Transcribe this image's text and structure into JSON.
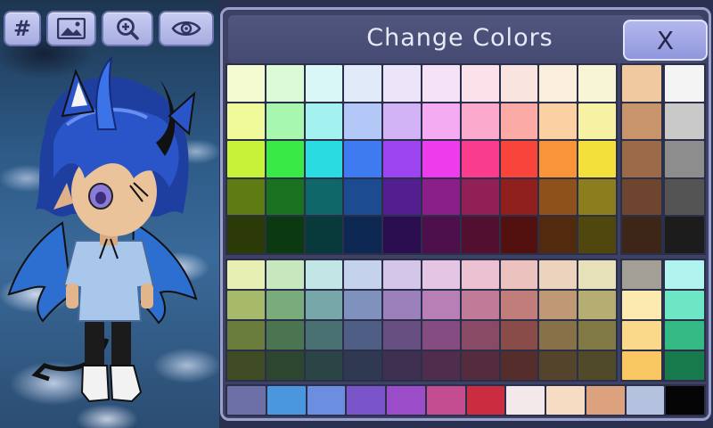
{
  "panel": {
    "title": "Change Colors",
    "close_label": "X"
  },
  "toolbar": {
    "hash_label": "#",
    "buttons": [
      "hex-code",
      "background-image",
      "zoom-in",
      "visibility"
    ]
  },
  "icons": {
    "image": "image-icon",
    "zoom": "zoom-in-icon",
    "eye": "eye-icon"
  },
  "palette_top": [
    [
      "#f4fbd0",
      "#dbfbd6",
      "#d8f7f6",
      "#e1eaf8",
      "#ece4f8",
      "#f6e2f6",
      "#fbe2ea",
      "#fae4df",
      "#faeedd",
      "#f7f5d6"
    ],
    [
      "#f1fa9a",
      "#a7f7ae",
      "#a3f2f0",
      "#b3c8f6",
      "#d1b2f5",
      "#f5abf1",
      "#fbaacd",
      "#fbaaa6",
      "#fbd0a3",
      "#f7f1a3"
    ],
    [
      "#c8f23a",
      "#39ea47",
      "#2adbe1",
      "#3f7bf0",
      "#9c44ef",
      "#ef3ceb",
      "#fa3c8f",
      "#f9443c",
      "#f99439",
      "#f3e03a"
    ],
    [
      "#5f7c12",
      "#18721f",
      "#10676a",
      "#1d4b90",
      "#531f8f",
      "#8a1f8a",
      "#902055",
      "#8f201e",
      "#8f511c",
      "#8c7e1e"
    ],
    [
      "#2c3a08",
      "#0b3a10",
      "#083a3b",
      "#0d2953",
      "#2a0e50",
      "#4e0f4d",
      "#520f2f",
      "#52100e",
      "#522a0d",
      "#4f470d"
    ]
  ],
  "palette_bottom": [
    [
      "#e7f0b2",
      "#c7e8be",
      "#c2e5e6",
      "#c5d2ec",
      "#d3c6e8",
      "#e4c5e3",
      "#ecc1d2",
      "#ecc2bf",
      "#ecd3bd",
      "#e7e1b9"
    ],
    [
      "#a7ba6a",
      "#79ab7d",
      "#77a7a8",
      "#7f91bd",
      "#9b80bb",
      "#b87eb6",
      "#c07b98",
      "#c07d79",
      "#bf9975",
      "#b6ad72"
    ],
    [
      "#6b7d3d",
      "#4b7450",
      "#4a7172",
      "#4f5e84",
      "#684f82",
      "#844c80",
      "#894a66",
      "#894c49",
      "#887048",
      "#827a45"
    ],
    [
      "#3f4c24",
      "#2c4630",
      "#2b4445",
      "#2f3952",
      "#3f2f50",
      "#502d4d",
      "#542c3e",
      "#552e2c",
      "#54442b",
      "#504a29"
    ]
  ],
  "skin_tones": [
    "#f1c9a1",
    "#c8946c",
    "#9b6a48",
    "#6e4630",
    "#3d2618"
  ],
  "grays": [
    "#f4f4f4",
    "#c9c9c9",
    "#8d8d8d",
    "#545454",
    "#1c1c1c"
  ],
  "extra_left": [
    "#a39e96",
    "#fdeab0",
    "#fbd98b",
    "#f9c862"
  ],
  "extra_right": [
    "#b1f4ef",
    "#6ce6c5",
    "#35b985",
    "#167a4c"
  ],
  "recent": [
    "#6c70a6",
    "#4a97df",
    "#6b8ee0",
    "#7a55c9",
    "#9a4cc9",
    "#c44d91",
    "#c92d3f",
    "#f3e8ea",
    "#f6dcc2",
    "#dca27e",
    "#b4c2df",
    "#050505"
  ]
}
